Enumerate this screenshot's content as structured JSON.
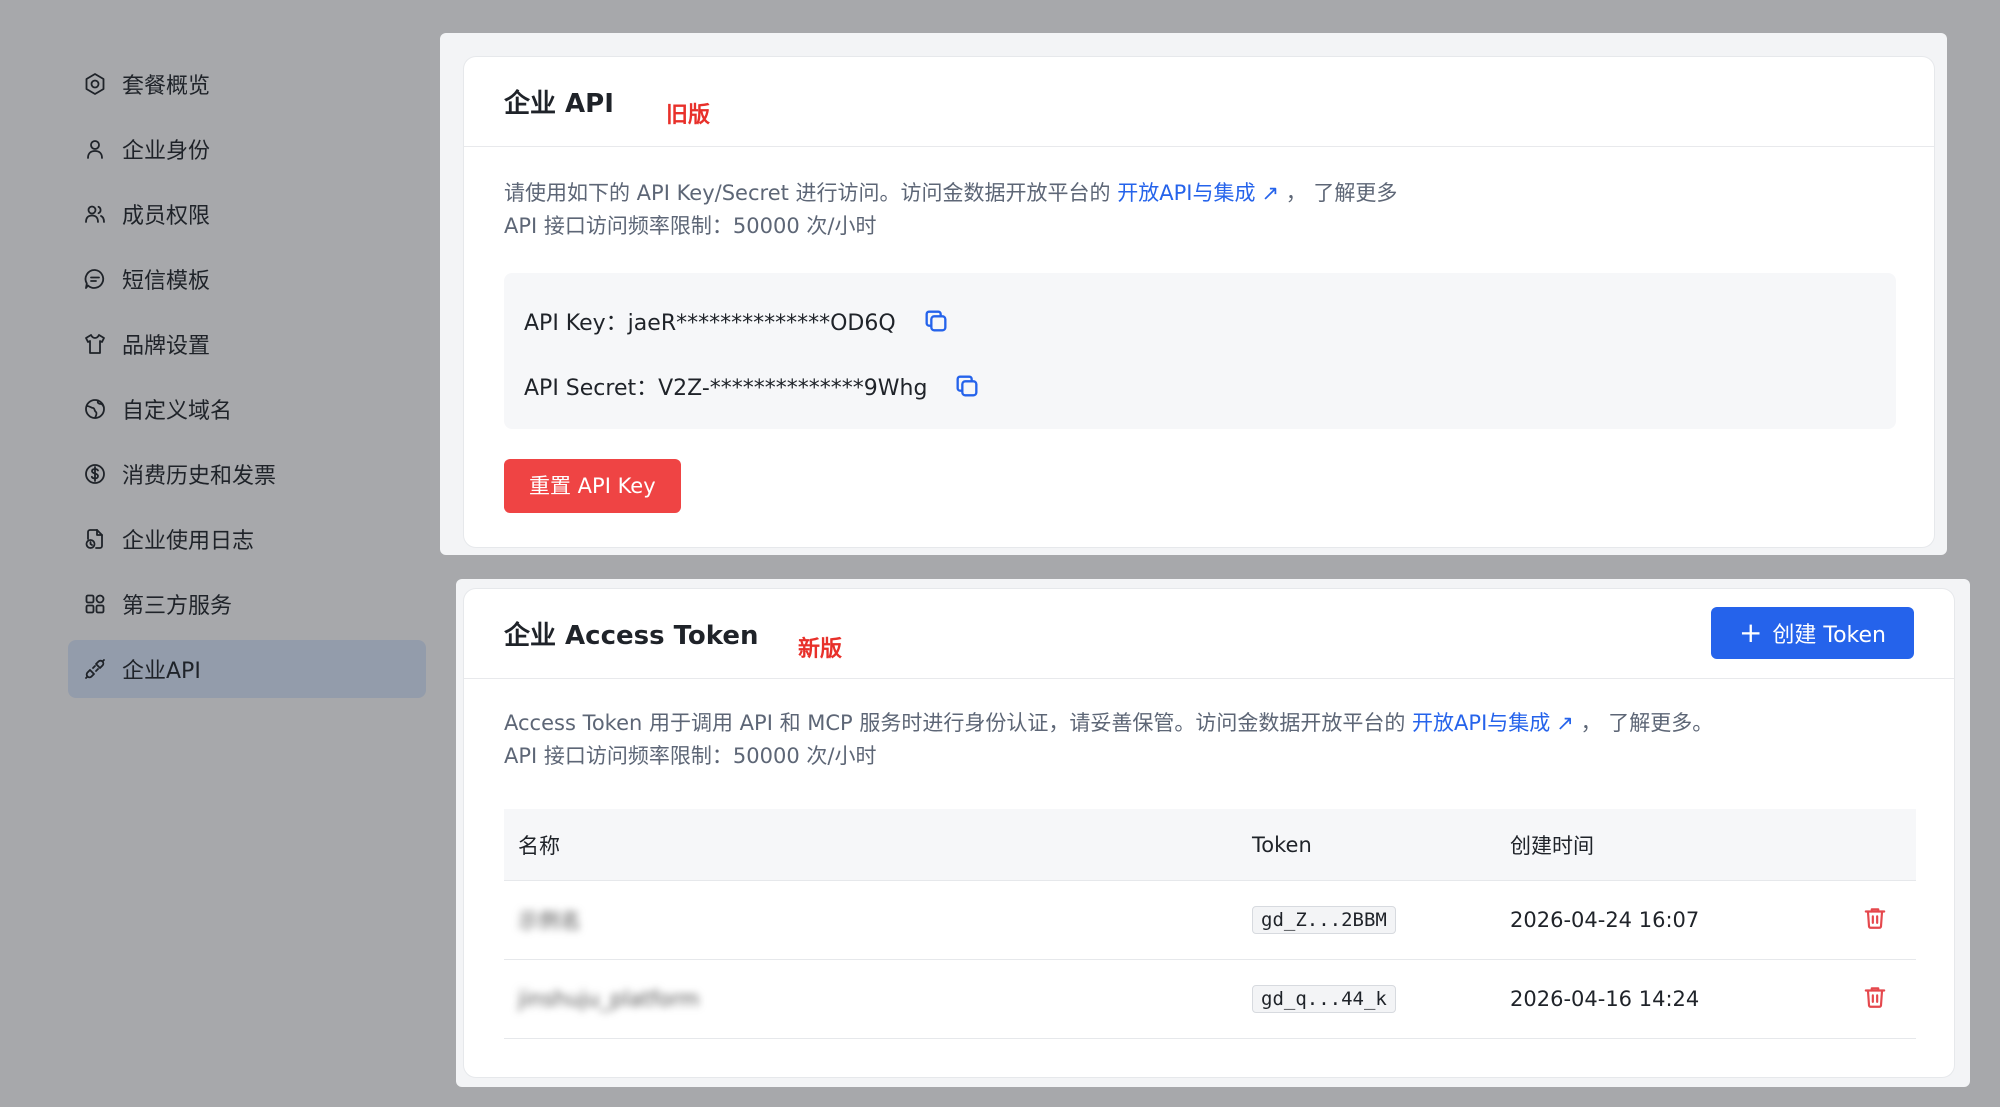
{
  "sidebar": {
    "items": [
      {
        "label": "套餐概览",
        "icon": "package-icon"
      },
      {
        "label": "企业身份",
        "icon": "user-icon"
      },
      {
        "label": "成员权限",
        "icon": "users-icon"
      },
      {
        "label": "短信模板",
        "icon": "message-icon"
      },
      {
        "label": "品牌设置",
        "icon": "shirt-icon"
      },
      {
        "label": "自定义域名",
        "icon": "globe-icon"
      },
      {
        "label": "消费历史和发票",
        "icon": "dollar-icon"
      },
      {
        "label": "企业使用日志",
        "icon": "file-log-icon"
      },
      {
        "label": "第三方服务",
        "icon": "grid-icon"
      },
      {
        "label": "企业API",
        "icon": "api-link-icon",
        "active": true
      }
    ]
  },
  "old_panel": {
    "title": "企业 API",
    "tag": "旧版",
    "desc_prefix": "请使用如下的 API Key/Secret 进行访问。访问金数据开放平台的",
    "desc_link": "开放API与集成",
    "desc_suffix": "， 了解更多",
    "rate_limit": "API 接口访问频率限制：50000 次/小时",
    "api_key": "API Key：jaeR**************OD6Q",
    "api_secret": "API Secret：V2Z-**************9Whg",
    "reset_button": "重置 API Key"
  },
  "new_panel": {
    "title": "企业 Access Token",
    "tag": "新版",
    "create_button": "创建 Token",
    "desc_prefix": "Access Token 用于调用 API 和 MCP 服务时进行身份认证，请妥善保管。访问金数据开放平台的",
    "desc_link": "开放API与集成",
    "desc_suffix": "， 了解更多。",
    "rate_limit": "API 接口访问频率限制：50000 次/小时",
    "table": {
      "headers": {
        "name": "名称",
        "token": "Token",
        "created": "创建时间"
      },
      "rows": [
        {
          "name": "示例名",
          "token": "gd_Z...2BBM",
          "created": "2026-04-24 16:07"
        },
        {
          "name": "jinshuju_platform",
          "token": "gd_q...44_k",
          "created": "2026-04-16 14:24"
        }
      ]
    }
  },
  "colors": {
    "accent": "#2563eb",
    "danger": "#ef4444",
    "tag": "#e8302a"
  }
}
